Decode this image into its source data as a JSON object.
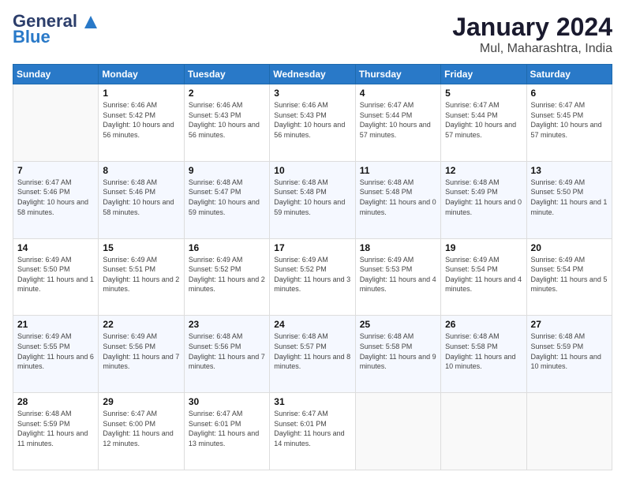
{
  "header": {
    "logo_general": "General",
    "logo_blue": "Blue",
    "title": "January 2024",
    "subtitle": "Mul, Maharashtra, India"
  },
  "days_of_week": [
    "Sunday",
    "Monday",
    "Tuesday",
    "Wednesday",
    "Thursday",
    "Friday",
    "Saturday"
  ],
  "weeks": [
    [
      {
        "day": "",
        "sunrise": "",
        "sunset": "",
        "daylight": ""
      },
      {
        "day": "1",
        "sunrise": "Sunrise: 6:46 AM",
        "sunset": "Sunset: 5:42 PM",
        "daylight": "Daylight: 10 hours and 56 minutes."
      },
      {
        "day": "2",
        "sunrise": "Sunrise: 6:46 AM",
        "sunset": "Sunset: 5:43 PM",
        "daylight": "Daylight: 10 hours and 56 minutes."
      },
      {
        "day": "3",
        "sunrise": "Sunrise: 6:46 AM",
        "sunset": "Sunset: 5:43 PM",
        "daylight": "Daylight: 10 hours and 56 minutes."
      },
      {
        "day": "4",
        "sunrise": "Sunrise: 6:47 AM",
        "sunset": "Sunset: 5:44 PM",
        "daylight": "Daylight: 10 hours and 57 minutes."
      },
      {
        "day": "5",
        "sunrise": "Sunrise: 6:47 AM",
        "sunset": "Sunset: 5:44 PM",
        "daylight": "Daylight: 10 hours and 57 minutes."
      },
      {
        "day": "6",
        "sunrise": "Sunrise: 6:47 AM",
        "sunset": "Sunset: 5:45 PM",
        "daylight": "Daylight: 10 hours and 57 minutes."
      }
    ],
    [
      {
        "day": "7",
        "sunrise": "Sunrise: 6:47 AM",
        "sunset": "Sunset: 5:46 PM",
        "daylight": "Daylight: 10 hours and 58 minutes."
      },
      {
        "day": "8",
        "sunrise": "Sunrise: 6:48 AM",
        "sunset": "Sunset: 5:46 PM",
        "daylight": "Daylight: 10 hours and 58 minutes."
      },
      {
        "day": "9",
        "sunrise": "Sunrise: 6:48 AM",
        "sunset": "Sunset: 5:47 PM",
        "daylight": "Daylight: 10 hours and 59 minutes."
      },
      {
        "day": "10",
        "sunrise": "Sunrise: 6:48 AM",
        "sunset": "Sunset: 5:48 PM",
        "daylight": "Daylight: 10 hours and 59 minutes."
      },
      {
        "day": "11",
        "sunrise": "Sunrise: 6:48 AM",
        "sunset": "Sunset: 5:48 PM",
        "daylight": "Daylight: 11 hours and 0 minutes."
      },
      {
        "day": "12",
        "sunrise": "Sunrise: 6:48 AM",
        "sunset": "Sunset: 5:49 PM",
        "daylight": "Daylight: 11 hours and 0 minutes."
      },
      {
        "day": "13",
        "sunrise": "Sunrise: 6:49 AM",
        "sunset": "Sunset: 5:50 PM",
        "daylight": "Daylight: 11 hours and 1 minute."
      }
    ],
    [
      {
        "day": "14",
        "sunrise": "Sunrise: 6:49 AM",
        "sunset": "Sunset: 5:50 PM",
        "daylight": "Daylight: 11 hours and 1 minute."
      },
      {
        "day": "15",
        "sunrise": "Sunrise: 6:49 AM",
        "sunset": "Sunset: 5:51 PM",
        "daylight": "Daylight: 11 hours and 2 minutes."
      },
      {
        "day": "16",
        "sunrise": "Sunrise: 6:49 AM",
        "sunset": "Sunset: 5:52 PM",
        "daylight": "Daylight: 11 hours and 2 minutes."
      },
      {
        "day": "17",
        "sunrise": "Sunrise: 6:49 AM",
        "sunset": "Sunset: 5:52 PM",
        "daylight": "Daylight: 11 hours and 3 minutes."
      },
      {
        "day": "18",
        "sunrise": "Sunrise: 6:49 AM",
        "sunset": "Sunset: 5:53 PM",
        "daylight": "Daylight: 11 hours and 4 minutes."
      },
      {
        "day": "19",
        "sunrise": "Sunrise: 6:49 AM",
        "sunset": "Sunset: 5:54 PM",
        "daylight": "Daylight: 11 hours and 4 minutes."
      },
      {
        "day": "20",
        "sunrise": "Sunrise: 6:49 AM",
        "sunset": "Sunset: 5:54 PM",
        "daylight": "Daylight: 11 hours and 5 minutes."
      }
    ],
    [
      {
        "day": "21",
        "sunrise": "Sunrise: 6:49 AM",
        "sunset": "Sunset: 5:55 PM",
        "daylight": "Daylight: 11 hours and 6 minutes."
      },
      {
        "day": "22",
        "sunrise": "Sunrise: 6:49 AM",
        "sunset": "Sunset: 5:56 PM",
        "daylight": "Daylight: 11 hours and 7 minutes."
      },
      {
        "day": "23",
        "sunrise": "Sunrise: 6:48 AM",
        "sunset": "Sunset: 5:56 PM",
        "daylight": "Daylight: 11 hours and 7 minutes."
      },
      {
        "day": "24",
        "sunrise": "Sunrise: 6:48 AM",
        "sunset": "Sunset: 5:57 PM",
        "daylight": "Daylight: 11 hours and 8 minutes."
      },
      {
        "day": "25",
        "sunrise": "Sunrise: 6:48 AM",
        "sunset": "Sunset: 5:58 PM",
        "daylight": "Daylight: 11 hours and 9 minutes."
      },
      {
        "day": "26",
        "sunrise": "Sunrise: 6:48 AM",
        "sunset": "Sunset: 5:58 PM",
        "daylight": "Daylight: 11 hours and 10 minutes."
      },
      {
        "day": "27",
        "sunrise": "Sunrise: 6:48 AM",
        "sunset": "Sunset: 5:59 PM",
        "daylight": "Daylight: 11 hours and 10 minutes."
      }
    ],
    [
      {
        "day": "28",
        "sunrise": "Sunrise: 6:48 AM",
        "sunset": "Sunset: 5:59 PM",
        "daylight": "Daylight: 11 hours and 11 minutes."
      },
      {
        "day": "29",
        "sunrise": "Sunrise: 6:47 AM",
        "sunset": "Sunset: 6:00 PM",
        "daylight": "Daylight: 11 hours and 12 minutes."
      },
      {
        "day": "30",
        "sunrise": "Sunrise: 6:47 AM",
        "sunset": "Sunset: 6:01 PM",
        "daylight": "Daylight: 11 hours and 13 minutes."
      },
      {
        "day": "31",
        "sunrise": "Sunrise: 6:47 AM",
        "sunset": "Sunset: 6:01 PM",
        "daylight": "Daylight: 11 hours and 14 minutes."
      },
      {
        "day": "",
        "sunrise": "",
        "sunset": "",
        "daylight": ""
      },
      {
        "day": "",
        "sunrise": "",
        "sunset": "",
        "daylight": ""
      },
      {
        "day": "",
        "sunrise": "",
        "sunset": "",
        "daylight": ""
      }
    ]
  ]
}
